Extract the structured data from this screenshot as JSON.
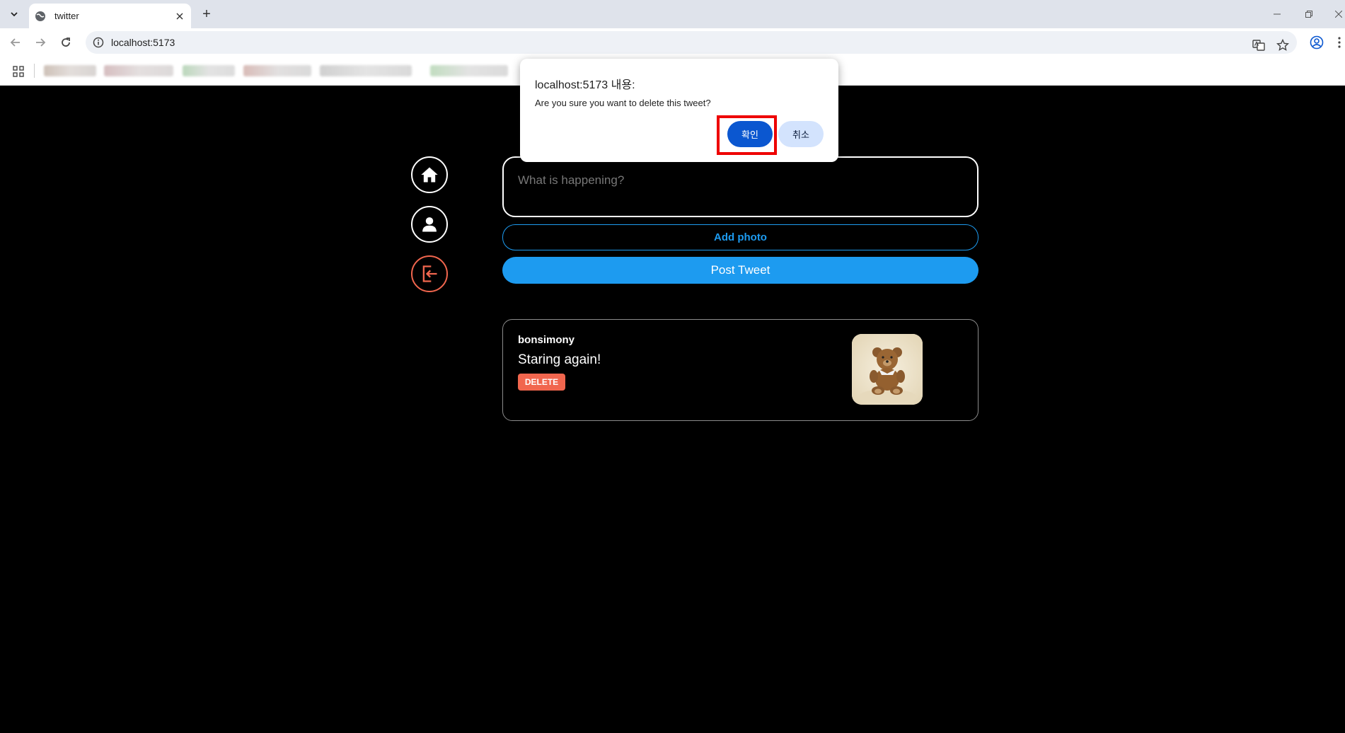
{
  "browser": {
    "tab_title": "twitter",
    "new_tab_label": "+",
    "url": "localhost:5173"
  },
  "compose": {
    "placeholder": "What is happening?",
    "add_photo_label": "Add photo",
    "post_label": "Post Tweet"
  },
  "tweet": {
    "username": "bonsimony",
    "text": "Staring again!",
    "delete_label": "DELETE"
  },
  "dialog": {
    "title": "localhost:5173 내용:",
    "message": "Are you sure you want to delete this tweet?",
    "confirm_label": "확인",
    "cancel_label": "취소"
  },
  "colors": {
    "accent": "#1d9bf0",
    "delete": "#f1664e",
    "highlight": "#e00000"
  },
  "icons": {
    "home": "home-icon",
    "profile": "profile-icon",
    "logout": "logout-icon"
  }
}
